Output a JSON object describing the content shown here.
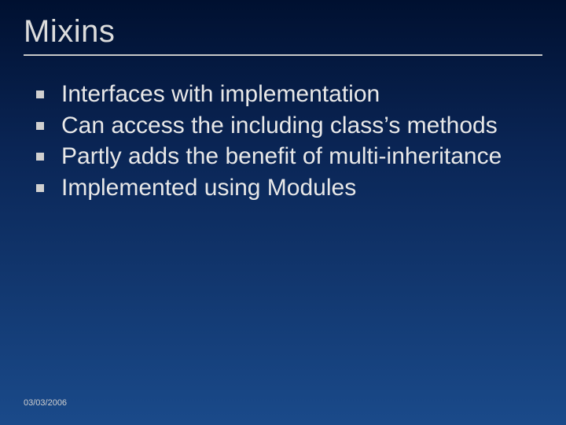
{
  "slide": {
    "title": "Mixins",
    "bullets": [
      "Interfaces with implementation",
      "Can access the including class’s methods",
      "Partly adds the benefit of multi-inheritance",
      "Implemented using Modules"
    ],
    "footer_date": "03/03/2006"
  }
}
